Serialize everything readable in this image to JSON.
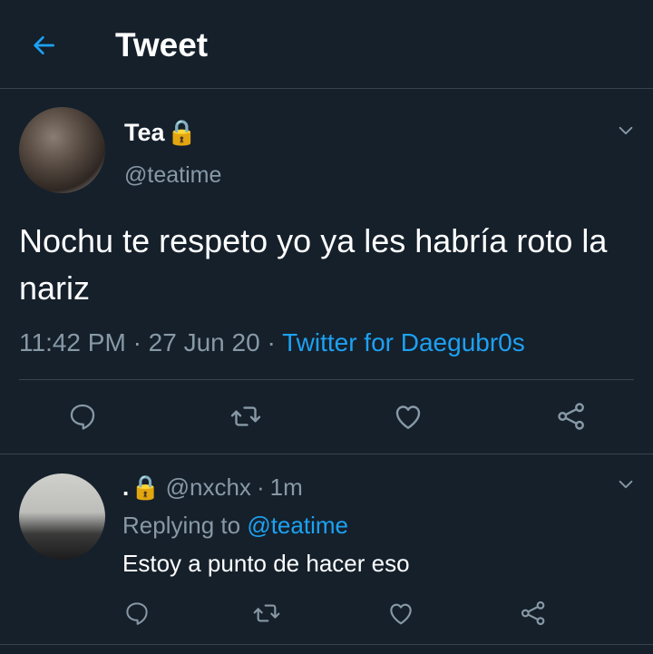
{
  "header": {
    "title": "Tweet"
  },
  "tweet": {
    "display_name": "Tea",
    "lock_emoji": "🔒",
    "handle": "@teatime",
    "text": "Nochu te respeto yo ya les habría roto la nariz",
    "time": "11:42 PM",
    "separator": "·",
    "date": "27 Jun 20",
    "source": "Twitter for Daegubr0s"
  },
  "reply": {
    "display_name": ".",
    "lock_emoji": "🔒",
    "handle": "@nxchx",
    "separator": "·",
    "time": "1m",
    "replying_prefix": "Replying to",
    "replying_to": "@teatime",
    "text": "Estoy a punto de hacer eso"
  },
  "colors": {
    "background": "#15202b",
    "accent": "#1da1f2",
    "secondary_text": "#8899a6",
    "divider": "#38444d"
  },
  "icons": {
    "back": "arrow-left-icon",
    "caret": "chevron-down-icon",
    "reply": "comment-icon",
    "retweet": "retweet-icon",
    "like": "heart-icon",
    "share": "share-icon"
  }
}
